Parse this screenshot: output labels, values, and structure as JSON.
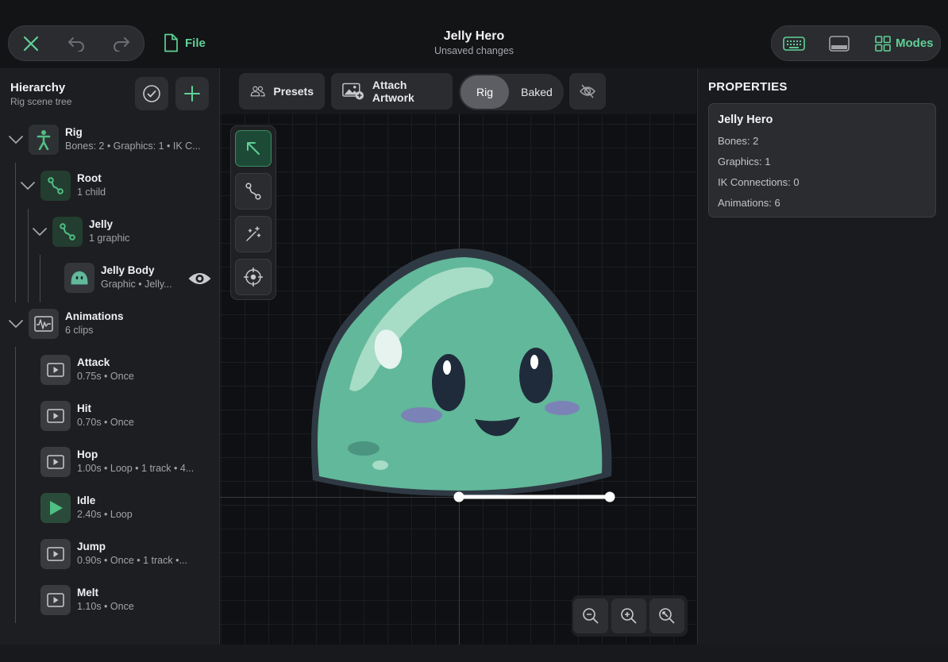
{
  "topbar": {
    "file_label": "File",
    "title": "Jelly Hero",
    "subtitle": "Unsaved changes",
    "modes_label": "Modes"
  },
  "hierarchy": {
    "title": "Hierarchy",
    "subtitle": "Rig scene tree",
    "nodes": [
      {
        "name": "Rig",
        "meta": "Bones: 2  •  Graphics: 1  •  IK C..."
      },
      {
        "name": "Root",
        "meta": "1 child"
      },
      {
        "name": "Jelly",
        "meta": "1 graphic"
      },
      {
        "name": "Jelly Body",
        "meta": "Graphic  •  Jelly..."
      },
      {
        "name": "Animations",
        "meta": "6 clips"
      }
    ],
    "clips": [
      {
        "name": "Attack",
        "meta": "0.75s  •  Once",
        "playing": false
      },
      {
        "name": "Hit",
        "meta": "0.70s  •  Once",
        "playing": false
      },
      {
        "name": "Hop",
        "meta": "1.00s  •  Loop  •  1 track  •  4...",
        "playing": false
      },
      {
        "name": "Idle",
        "meta": "2.40s  •  Loop",
        "playing": true
      },
      {
        "name": "Jump",
        "meta": "0.90s  •  Once  •  1 track  •...",
        "playing": false
      },
      {
        "name": "Melt",
        "meta": "1.10s  •  Once",
        "playing": false
      }
    ]
  },
  "canvas_toolbar": {
    "presets_label": "Presets",
    "attach_label": "Attach Artwork",
    "mode_rig": "Rig",
    "mode_baked": "Baked",
    "active_mode": "Rig"
  },
  "properties": {
    "title": "PROPERTIES",
    "name": "Jelly Hero",
    "rows": [
      "Bones: 2",
      "Graphics: 1",
      "IK Connections: 0",
      "Animations: 6"
    ]
  },
  "colors": {
    "accent": "#5fd196",
    "slime": "#62b89a",
    "background": "#111214"
  },
  "icons": [
    "close-icon",
    "undo-icon",
    "redo-icon",
    "file-icon",
    "keyboard-icon",
    "panel-icon",
    "grid-icon",
    "check-circle-icon",
    "plus-icon",
    "person-icon",
    "bone-icon",
    "slime-thumbnail",
    "eye-icon",
    "waveform-icon",
    "play-icon",
    "people-icon",
    "image-add-icon",
    "hidden-icon",
    "select-arrow-icon",
    "bone-tool-icon",
    "magic-wand-icon",
    "crosshair-icon",
    "zoom-out-icon",
    "zoom-in-icon",
    "zoom-fit-icon"
  ]
}
